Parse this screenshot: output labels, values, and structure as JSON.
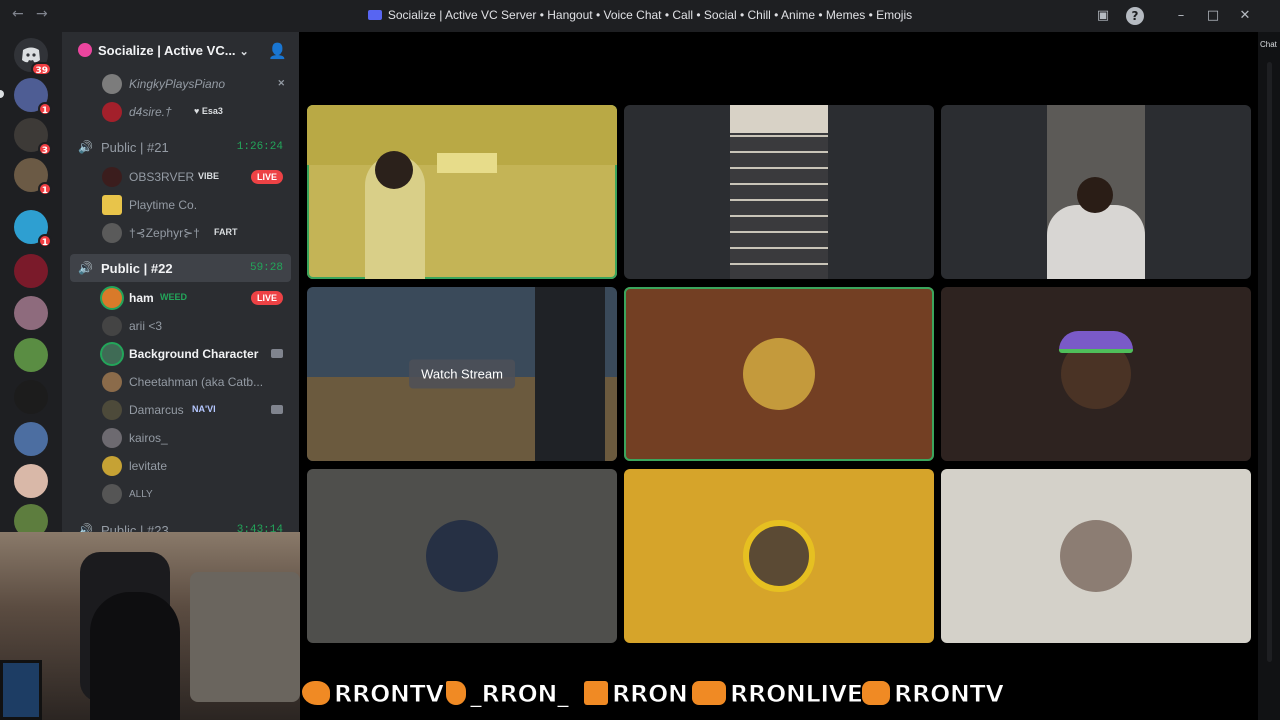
{
  "window": {
    "title": "Socialize | Active VC Server • Hangout • Voice Chat • Call • Social • Chill • Anime • Memes • Emojis",
    "back": "←",
    "forward": "→"
  },
  "rail": {
    "home_badge": "39",
    "guild_badges": [
      "1",
      "3",
      "1",
      "1"
    ]
  },
  "sidebar": {
    "server_name": "Socialize | Active VC...",
    "users_top": [
      {
        "name": "KingkyPlaysPiano"
      },
      {
        "name": "d4sire.†",
        "tag": "♥ Esa3"
      }
    ],
    "channel_21": {
      "name": "Public | #21",
      "time": "1:26:24"
    },
    "users_21": [
      {
        "name": "OBS3RVER",
        "tag": "VIBE",
        "live": "LIVE"
      },
      {
        "name": "Playtime Co."
      },
      {
        "name": "†⊰Zephyr⊱†",
        "tag": "FART"
      }
    ],
    "channel_22": {
      "name": "Public | #22",
      "time": "59:28"
    },
    "users_22": [
      {
        "name": "ham",
        "tag": "WEED",
        "live": "LIVE"
      },
      {
        "name": "arii <3"
      },
      {
        "name": "Background Character"
      },
      {
        "name": "Cheetahman (aka Catb..."
      },
      {
        "name": "Damarcus",
        "tag": "NA'VI"
      },
      {
        "name": "kairos_"
      },
      {
        "name": "levitate"
      },
      {
        "name": "ALLY"
      }
    ],
    "channel_23": {
      "name": "Public | #23",
      "time": "3:43:14"
    }
  },
  "stage": {
    "watch_stream": "Watch Stream"
  },
  "right_panel": {
    "label": "Chat"
  },
  "banner": {
    "twitter": "RRONTV",
    "tiktok": "_RRON_",
    "kick": "RRON",
    "youtube": "RRONLIVE",
    "instagram": "RRONTV"
  },
  "colors": {
    "speaking_outline": "#3ba55d",
    "live_badge": "#ed4245",
    "voice_green": "#23a55a"
  }
}
